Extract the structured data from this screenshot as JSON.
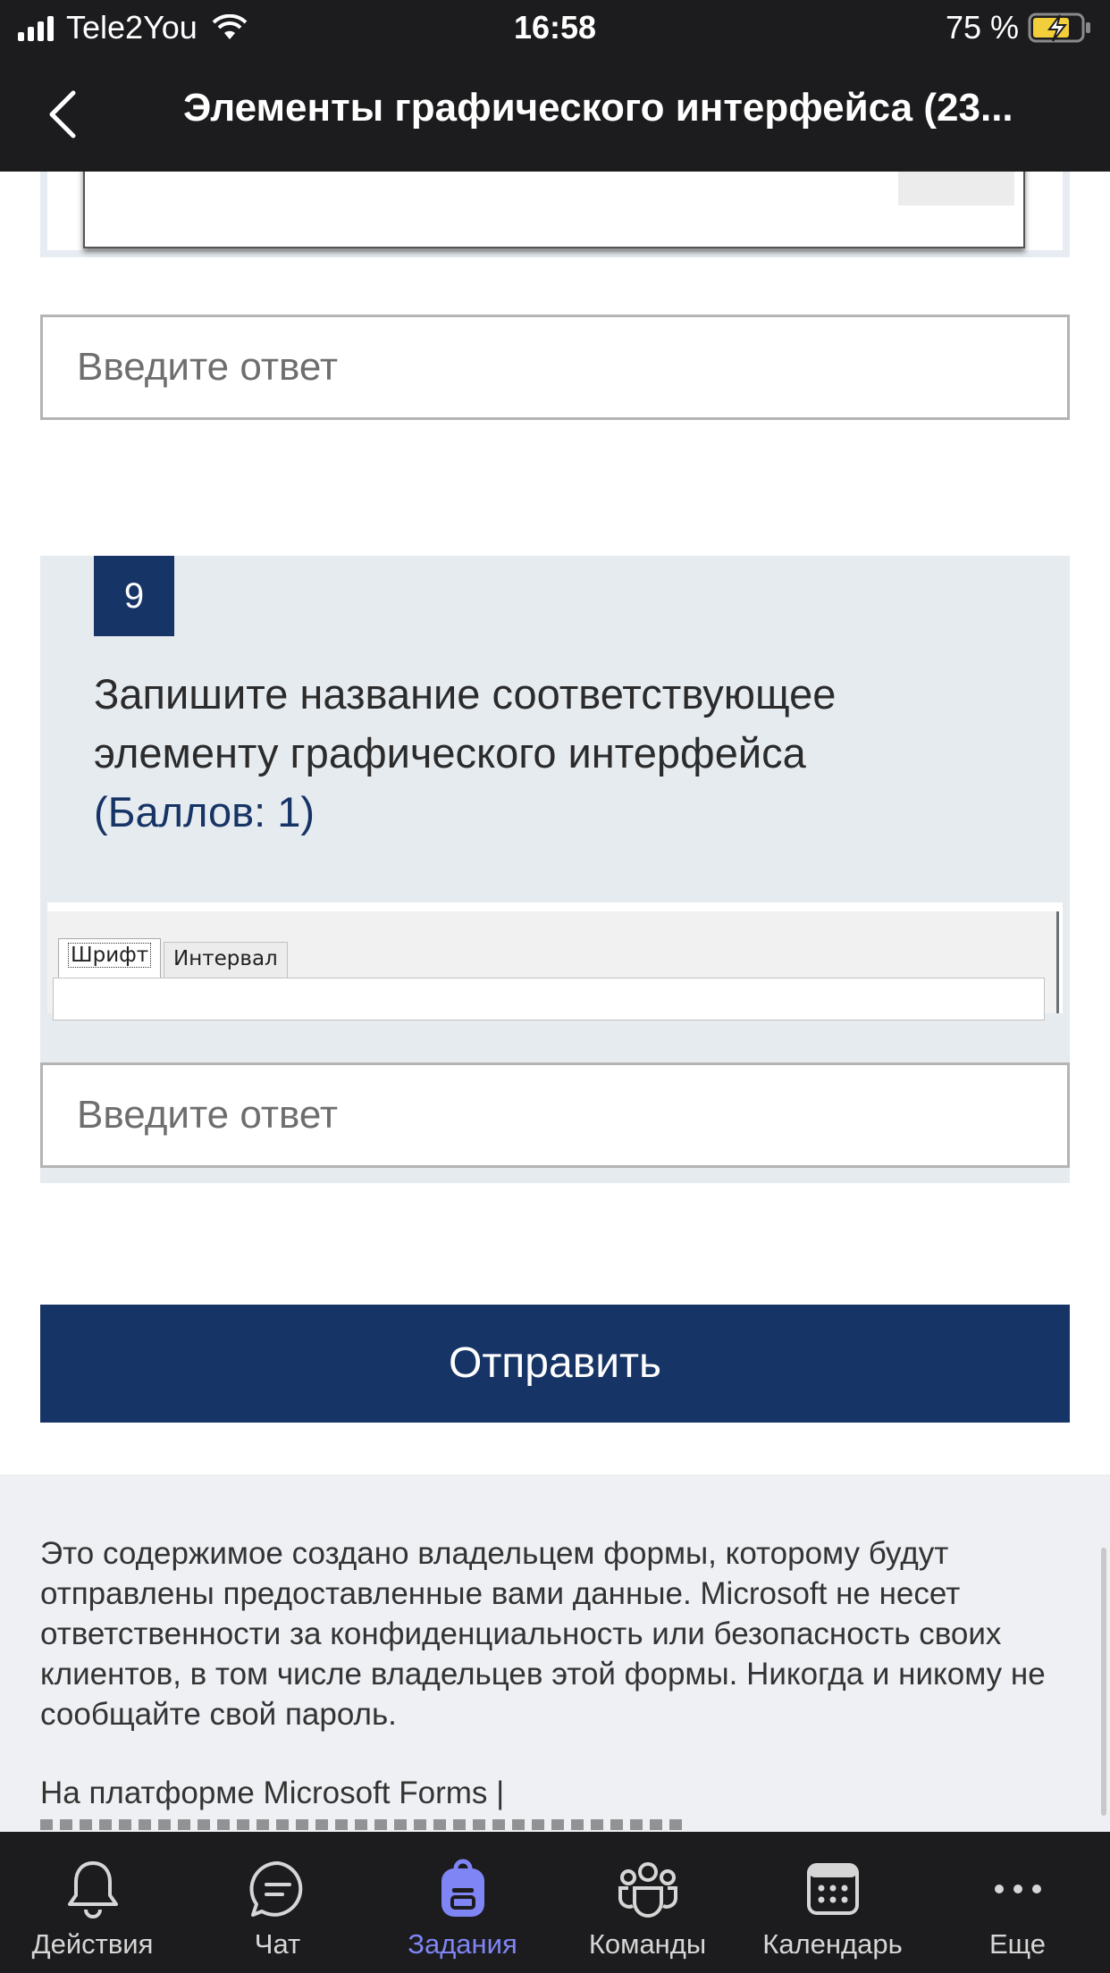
{
  "status_bar": {
    "carrier": "Tele2You",
    "time": "16:58",
    "battery": "75 %"
  },
  "nav": {
    "title": "Элементы графического интерфейса (23..."
  },
  "form": {
    "answer_placeholder_1": "Введите ответ",
    "question": {
      "number": "9",
      "text": "Запишите название соответствующее элементу графического интерфейса",
      "points": "(Баллов: 1)",
      "image_tabs": [
        "Шрифт",
        "Интервал"
      ]
    },
    "answer_placeholder_2": "Введите ответ",
    "submit_label": "Отправить"
  },
  "footer": {
    "disclaimer": "Это содержимое создано владельцем формы, которому будут отправлены предоставленные вами данные. Microsoft не несет ответственности за конфиденциальность или безопасность своих клиентов, в том числе владельцев этой формы. Никогда и никому не сообщайте свой пароль.",
    "powered_by": "На платформе Microsoft Forms |"
  },
  "tabbar": {
    "items": [
      {
        "label": "Действия",
        "icon": "bell-icon",
        "active": false
      },
      {
        "label": "Чат",
        "icon": "chat-icon",
        "active": false
      },
      {
        "label": "Задания",
        "icon": "backpack-icon",
        "active": true
      },
      {
        "label": "Команды",
        "icon": "teams-icon",
        "active": false
      },
      {
        "label": "Календарь",
        "icon": "calendar-icon",
        "active": false
      },
      {
        "label": "Еще",
        "icon": "more-icon",
        "active": false
      }
    ],
    "active_color": "#7f85f5"
  },
  "colors": {
    "accent": "#173466",
    "card_bg": "#e6ebf0",
    "bars_bg": "#1c1c1e"
  }
}
